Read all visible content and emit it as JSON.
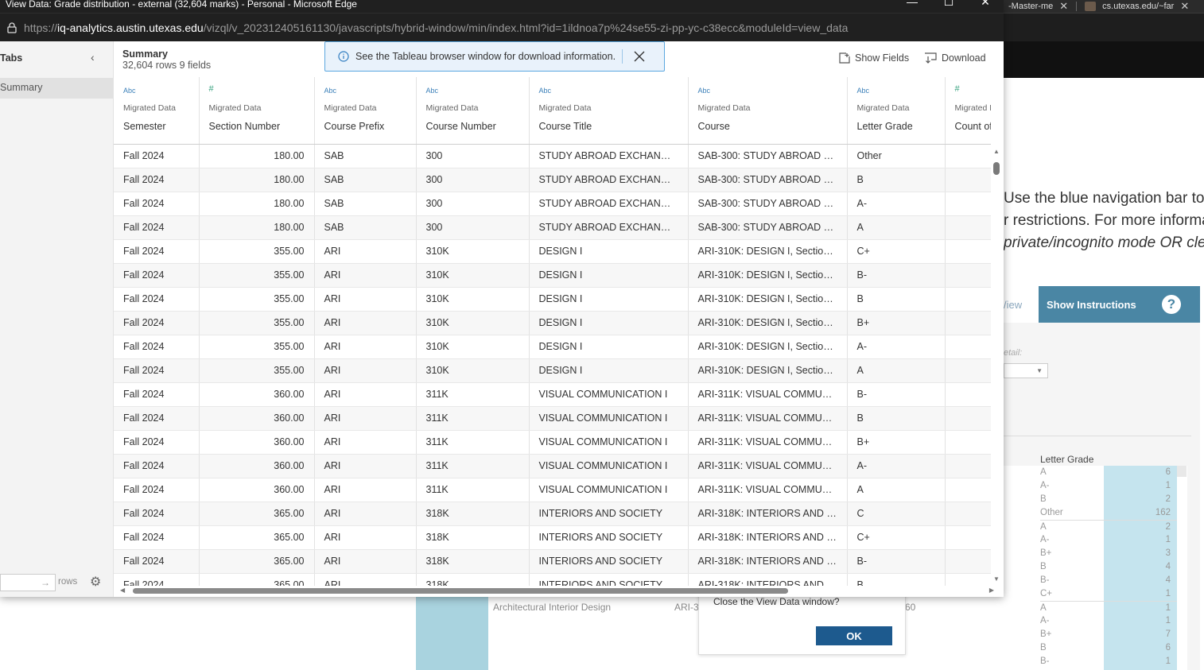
{
  "window": {
    "title": "View Data: Grade distribution - external (32,604 marks) - Personal - Microsoft Edge",
    "url_prefix": "https://",
    "url_host": "iq-analytics.austin.utexas.edu",
    "url_path": "/vizql/v_202312405161130/javascripts/hybrid-window/min/index.html?id=1ildnoa7p%24se55-zi-pp-yc-c38ecc&moduleId=view_data"
  },
  "sidebar": {
    "title": "Tabs",
    "items": [
      "Summary"
    ],
    "rows_label": "rows",
    "rows_arrow": "→"
  },
  "header": {
    "title": "Summary",
    "meta": "32,604 rows  9 fields",
    "banner_text": "See the Tableau browser window for download information.",
    "show_fields_label": "Show Fields",
    "download_label": "Download"
  },
  "table": {
    "columns": [
      {
        "type": "Abc",
        "source": "Migrated Data",
        "name": "Semester"
      },
      {
        "type": "#",
        "source": "Migrated Data",
        "name": "Section Number"
      },
      {
        "type": "Abc",
        "source": "Migrated Data",
        "name": "Course Prefix"
      },
      {
        "type": "Abc",
        "source": "Migrated Data",
        "name": "Course Number"
      },
      {
        "type": "Abc",
        "source": "Migrated Data",
        "name": "Course Title"
      },
      {
        "type": "Abc",
        "source": "Migrated Data",
        "name": "Course"
      },
      {
        "type": "Abc",
        "source": "Migrated Data",
        "name": "Letter Grade"
      },
      {
        "type": "#",
        "source": "Migrated Dat",
        "name": "Count of le"
      }
    ],
    "rows": [
      [
        "Fall 2024",
        "180.00",
        "SAB",
        "300",
        "STUDY ABROAD EXCHANGE ...",
        "SAB-300: STUDY ABROAD E...",
        "Other",
        ""
      ],
      [
        "Fall 2024",
        "180.00",
        "SAB",
        "300",
        "STUDY ABROAD EXCHANGE ...",
        "SAB-300: STUDY ABROAD E...",
        "B",
        ""
      ],
      [
        "Fall 2024",
        "180.00",
        "SAB",
        "300",
        "STUDY ABROAD EXCHANGE ...",
        "SAB-300: STUDY ABROAD E...",
        "A-",
        ""
      ],
      [
        "Fall 2024",
        "180.00",
        "SAB",
        "300",
        "STUDY ABROAD EXCHANGE ...",
        "SAB-300: STUDY ABROAD E...",
        "A",
        ""
      ],
      [
        "Fall 2024",
        "355.00",
        "ARI",
        "310K",
        "DESIGN I",
        "ARI-310K: DESIGN I, Section ...",
        "C+",
        ""
      ],
      [
        "Fall 2024",
        "355.00",
        "ARI",
        "310K",
        "DESIGN I",
        "ARI-310K: DESIGN I, Section ...",
        "B-",
        ""
      ],
      [
        "Fall 2024",
        "355.00",
        "ARI",
        "310K",
        "DESIGN I",
        "ARI-310K: DESIGN I, Section ...",
        "B",
        ""
      ],
      [
        "Fall 2024",
        "355.00",
        "ARI",
        "310K",
        "DESIGN I",
        "ARI-310K: DESIGN I, Section ...",
        "B+",
        ""
      ],
      [
        "Fall 2024",
        "355.00",
        "ARI",
        "310K",
        "DESIGN I",
        "ARI-310K: DESIGN I, Section ...",
        "A-",
        ""
      ],
      [
        "Fall 2024",
        "355.00",
        "ARI",
        "310K",
        "DESIGN I",
        "ARI-310K: DESIGN I, Section ...",
        "A",
        ""
      ],
      [
        "Fall 2024",
        "360.00",
        "ARI",
        "311K",
        "VISUAL COMMUNICATION I",
        "ARI-311K: VISUAL COMMUNI...",
        "B-",
        ""
      ],
      [
        "Fall 2024",
        "360.00",
        "ARI",
        "311K",
        "VISUAL COMMUNICATION I",
        "ARI-311K: VISUAL COMMUNI...",
        "B",
        ""
      ],
      [
        "Fall 2024",
        "360.00",
        "ARI",
        "311K",
        "VISUAL COMMUNICATION I",
        "ARI-311K: VISUAL COMMUNI...",
        "B+",
        ""
      ],
      [
        "Fall 2024",
        "360.00",
        "ARI",
        "311K",
        "VISUAL COMMUNICATION I",
        "ARI-311K: VISUAL COMMUNI...",
        "A-",
        ""
      ],
      [
        "Fall 2024",
        "360.00",
        "ARI",
        "311K",
        "VISUAL COMMUNICATION I",
        "ARI-311K: VISUAL COMMUNI...",
        "A",
        ""
      ],
      [
        "Fall 2024",
        "365.00",
        "ARI",
        "318K",
        "INTERIORS AND SOCIETY",
        "ARI-318K: INTERIORS AND S...",
        "C",
        ""
      ],
      [
        "Fall 2024",
        "365.00",
        "ARI",
        "318K",
        "INTERIORS AND SOCIETY",
        "ARI-318K: INTERIORS AND S...",
        "C+",
        ""
      ],
      [
        "Fall 2024",
        "365.00",
        "ARI",
        "318K",
        "INTERIORS AND SOCIETY",
        "ARI-318K: INTERIORS AND S...",
        "B-",
        ""
      ],
      [
        "Fall 2024",
        "365.00",
        "ARI",
        "318K",
        "INTERIORS AND SOCIETY",
        "ARI-318K: INTERIORS AND S...",
        "B",
        ""
      ]
    ]
  },
  "background": {
    "tabs": [
      {
        "label": "-Master-me"
      },
      {
        "label": "cs.utexas.edu/~far"
      }
    ],
    "instructions_line1": "Use the blue navigation bar to",
    "instructions_line2": "r restrictions. For more informa",
    "instructions_line3": "private/incognito mode OR cle",
    "view_label": "/iew",
    "show_instructions_label": "Show Instructions",
    "help_glyph": "?",
    "detail_label": "etail:",
    "letter_grade_header": "Letter Grade",
    "grades": [
      {
        "g": "A",
        "v": "6"
      },
      {
        "g": "A-",
        "v": "1"
      },
      {
        "g": "B",
        "v": "2"
      },
      {
        "g": "Other",
        "v": "162"
      },
      {
        "g": "A",
        "v": "2"
      },
      {
        "g": "A-",
        "v": "1"
      },
      {
        "g": "B+",
        "v": "3"
      },
      {
        "g": "B",
        "v": "4"
      },
      {
        "g": "B-",
        "v": "4"
      },
      {
        "g": "C+",
        "v": "1"
      },
      {
        "g": "A",
        "v": "1"
      },
      {
        "g": "A-",
        "v": "1"
      },
      {
        "g": "B+",
        "v": "7"
      },
      {
        "g": "B",
        "v": "6"
      },
      {
        "g": "B-",
        "v": "1"
      }
    ],
    "program_label": "Architectural Interior Design",
    "course_fragment": "ARI-3",
    "number_fragment": "60",
    "close_dialog_message": "Close the View Data window?",
    "ok_label": "OK"
  },
  "colors": {
    "accent_blue": "#4a86a4",
    "ok_button": "#1d5a8e",
    "banner_border": "#5ba7e0"
  }
}
